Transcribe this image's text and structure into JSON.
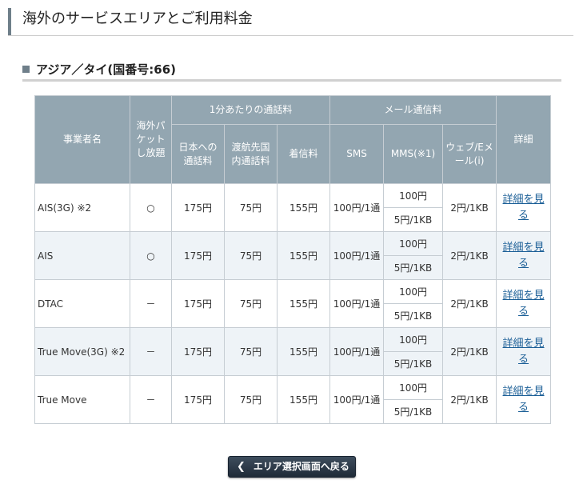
{
  "page_title": "海外のサービスエリアとご利用料金",
  "section_title": "アジア／タイ(国番号:66)",
  "table": {
    "headers": {
      "operator": "事業者名",
      "packet": "海外パケットし放題",
      "per_minute_group": "1分あたりの通話料",
      "call_to_japan": "日本への通話料",
      "call_local": "渡航先国内通話料",
      "incoming": "着信料",
      "mail_group": "メール通信料",
      "sms": "SMS",
      "mms": "MMS(※1)",
      "web": "ウェブ/Eメール(i)",
      "detail": "詳細"
    },
    "rows": [
      {
        "operator": "AIS(3G) ※2",
        "packet": "○",
        "call_to_japan": "175円",
        "call_local": "75円",
        "incoming": "155円",
        "sms": "100円/1通",
        "mms_top": "100円",
        "mms_bottom": "5円/1KB",
        "web": "2円/1KB",
        "detail": "詳細を見る"
      },
      {
        "operator": "AIS",
        "packet": "○",
        "call_to_japan": "175円",
        "call_local": "75円",
        "incoming": "155円",
        "sms": "100円/1通",
        "mms_top": "100円",
        "mms_bottom": "5円/1KB",
        "web": "2円/1KB",
        "detail": "詳細を見る"
      },
      {
        "operator": "DTAC",
        "packet": "－",
        "call_to_japan": "175円",
        "call_local": "75円",
        "incoming": "155円",
        "sms": "100円/1通",
        "mms_top": "100円",
        "mms_bottom": "5円/1KB",
        "web": "2円/1KB",
        "detail": "詳細を見る"
      },
      {
        "operator": "True Move(3G) ※2",
        "packet": "－",
        "call_to_japan": "175円",
        "call_local": "75円",
        "incoming": "155円",
        "sms": "100円/1通",
        "mms_top": "100円",
        "mms_bottom": "5円/1KB",
        "web": "2円/1KB",
        "detail": "詳細を見る"
      },
      {
        "operator": "True Move",
        "packet": "－",
        "call_to_japan": "175円",
        "call_local": "75円",
        "incoming": "155円",
        "sms": "100円/1通",
        "mms_top": "100円",
        "mms_bottom": "5円/1KB",
        "web": "2円/1KB",
        "detail": "詳細を見る"
      }
    ]
  },
  "back_button": {
    "icon": "chevron-left-icon",
    "label": "エリア選択画面へ戻る"
  }
}
